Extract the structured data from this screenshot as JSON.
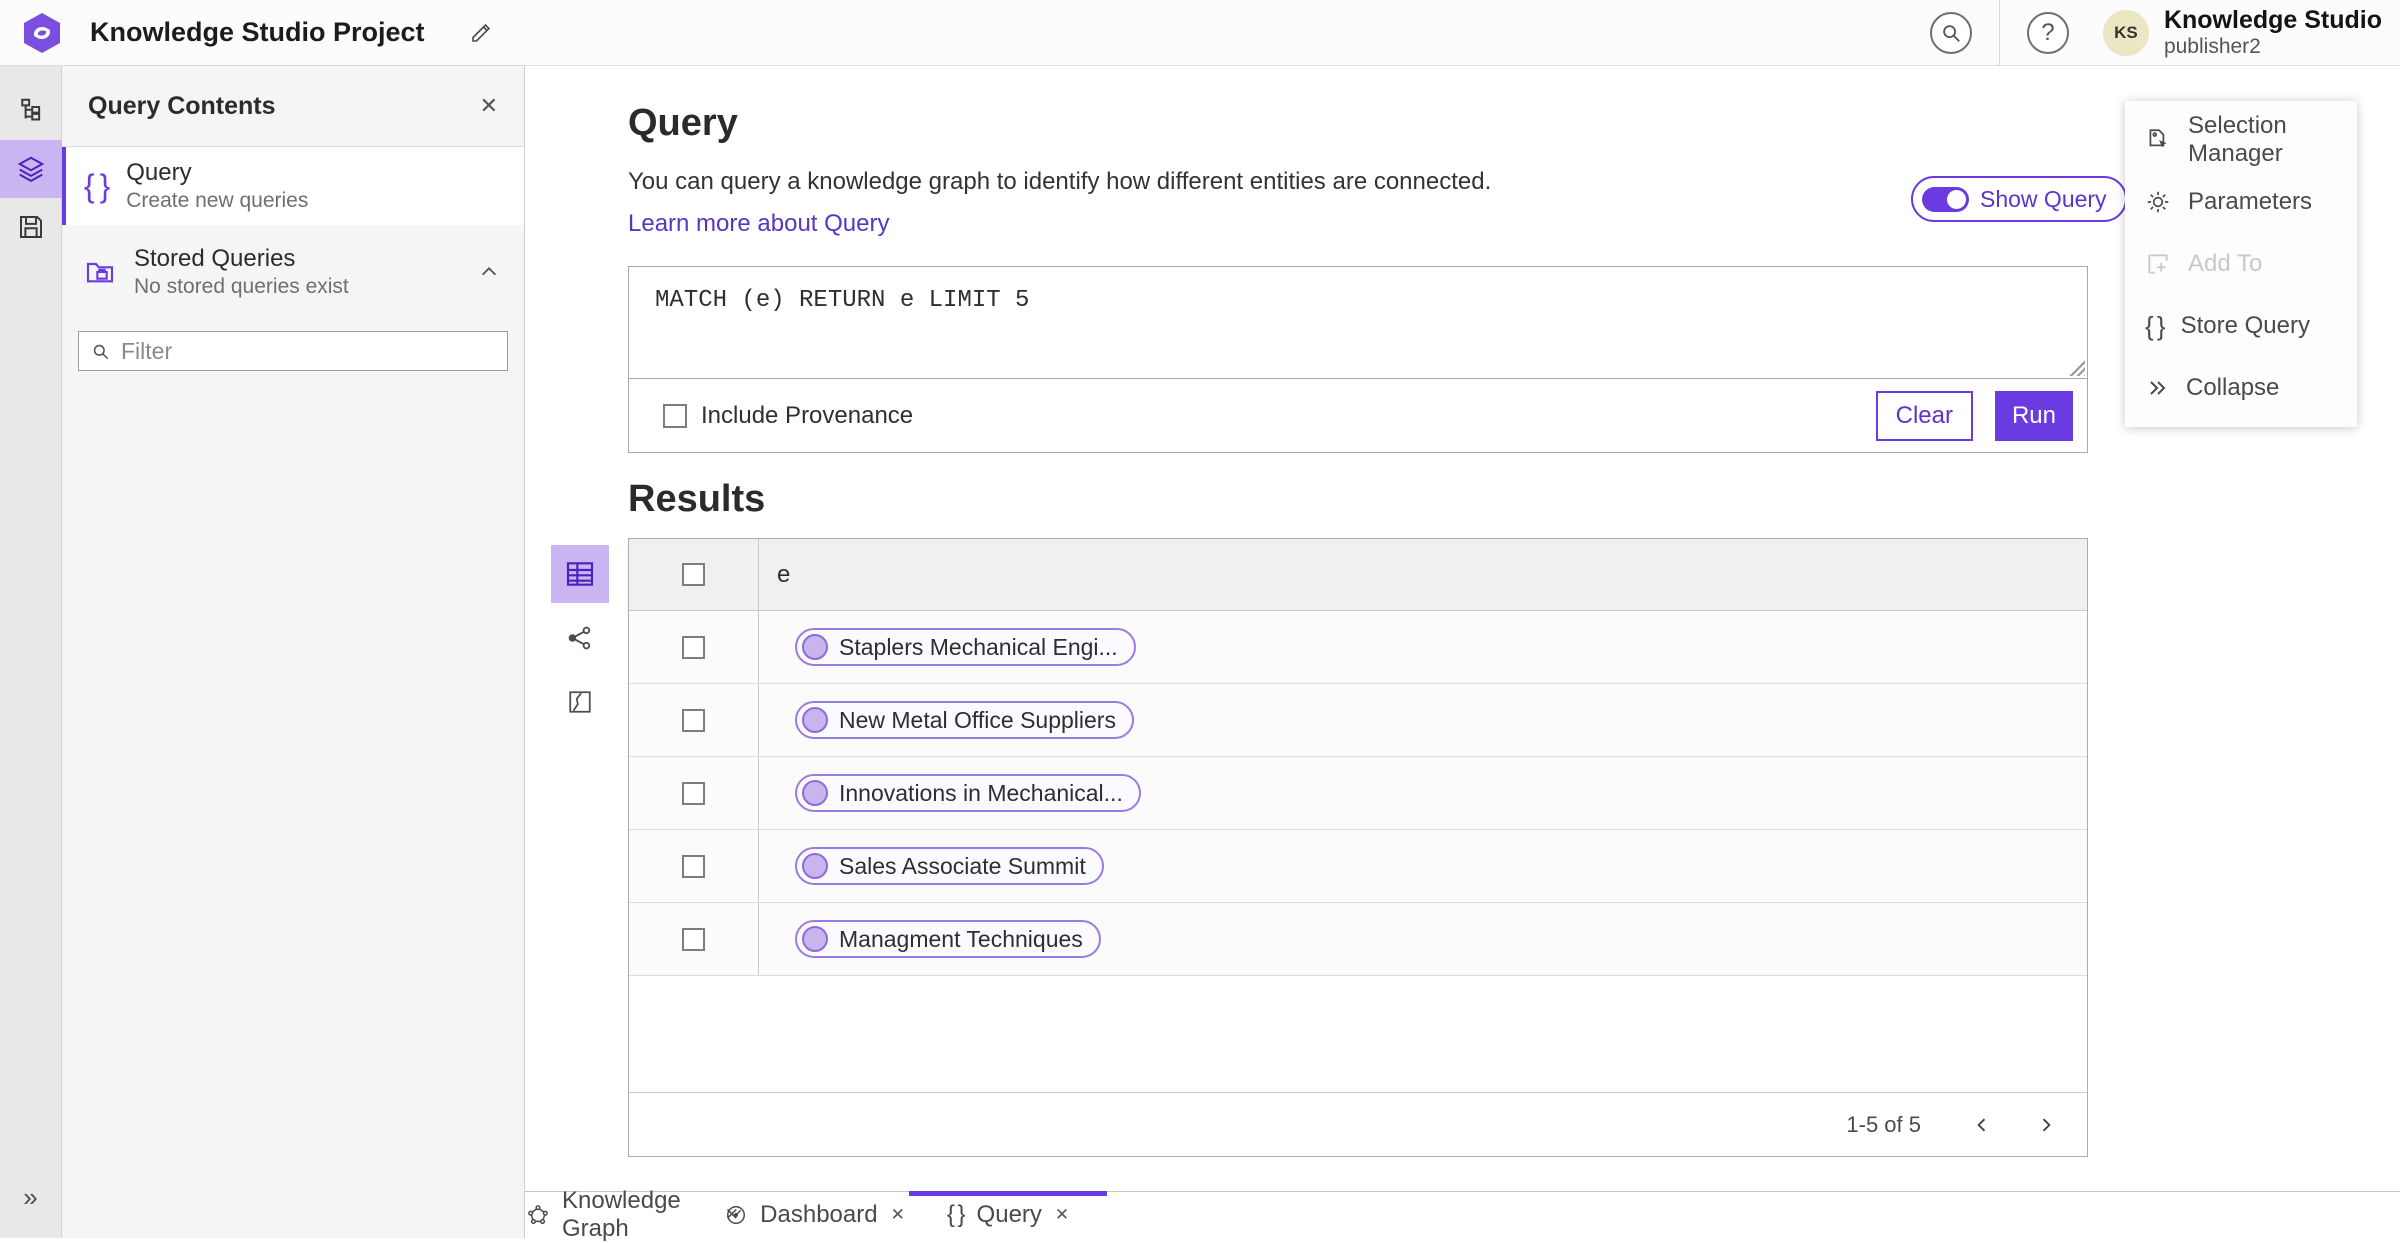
{
  "colors": {
    "accent": "#6a3be0",
    "selected_tile_bg": "#c9b5f2",
    "avatar_bg": "#ece7c3"
  },
  "glyphs": {
    "close": "✕",
    "braces": "{ }",
    "help": "?",
    "collapse": "»"
  },
  "header": {
    "title": "Knowledge Studio Project",
    "user_name": "Knowledge Studio",
    "user_role": "publisher2",
    "avatar_initials": "KS"
  },
  "contents_panel": {
    "title": "Query Contents",
    "query_item": {
      "label": "Query",
      "description": "Create new queries"
    },
    "stored_item": {
      "label": "Stored Queries",
      "description": "No stored queries exist"
    },
    "filter_placeholder": "Filter"
  },
  "query_section": {
    "title": "Query",
    "description": "You can query a knowledge graph to identify how different entities are connected.",
    "learn_more": "Learn more about Query",
    "show_query_label": "Show Query",
    "query_text": "MATCH (e) RETURN e LIMIT 5",
    "include_provenance_label": "Include Provenance",
    "clear_label": "Clear",
    "run_label": "Run"
  },
  "results": {
    "title": "Results",
    "column_header": "e",
    "rows": [
      "Staplers Mechanical Engi...",
      "New Metal Office Suppliers",
      "Innovations in Mechanical...",
      "Sales Associate Summit",
      "Managment Techniques"
    ],
    "pagination": "1-5 of 5"
  },
  "actions_panel": {
    "selection_manager": "Selection Manager",
    "parameters": "Parameters",
    "add_to": "Add To",
    "store_query": "Store Query",
    "collapse": "Collapse"
  },
  "tabs": {
    "knowledge_graph": "Knowledge Graph",
    "dashboard": "Dashboard",
    "query": "Query"
  }
}
